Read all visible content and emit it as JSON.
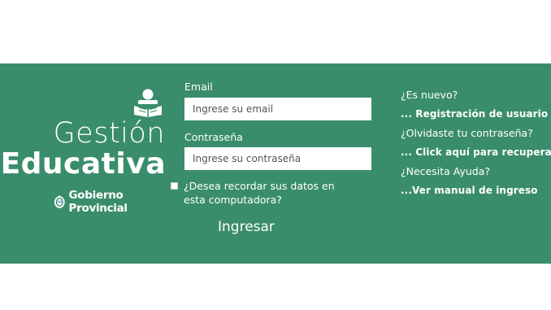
{
  "brand": {
    "title_light": "Gestión",
    "title_bold": "Educativa",
    "government": "Gobierno Provincial",
    "logo_icon": "student-reading-icon",
    "seal_icon": "provincial-seal-icon"
  },
  "colors": {
    "band_bg": "#3a8d6c",
    "text": "#ffffff",
    "input_bg": "#ffffff",
    "placeholder": "#555555"
  },
  "form": {
    "email_label": "Email",
    "email_placeholder": "Ingrese su email",
    "email_value": "",
    "password_label": "Contraseña",
    "password_placeholder": "Ingrese su contraseña",
    "password_value": "",
    "remember_label": "¿Desea recordar sus datos en esta computadora?",
    "remember_checked": false,
    "submit_label": "Ingresar"
  },
  "links": {
    "new_question": "¿Es nuevo?",
    "register": "... Registración de usuario",
    "forgot_question": "¿Olvidaste tu contraseña?",
    "recover": "... Click aquí para recuperarla",
    "help_question": "¿Necesita Ayuda?",
    "manual": "...Ver manual de ingreso"
  }
}
